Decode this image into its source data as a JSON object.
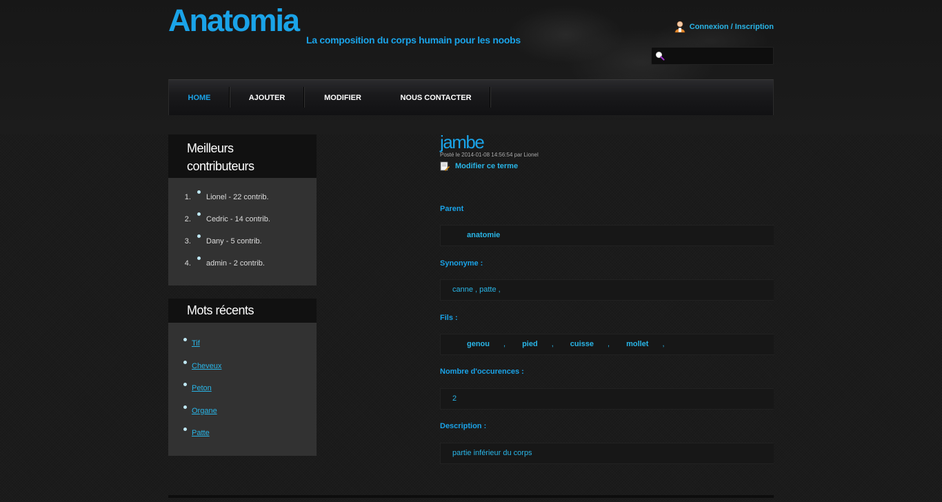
{
  "site": {
    "title": "Anatomia",
    "tagline": "La composition du corps humain pour les noobs",
    "login_label": "Connexion / Inscription",
    "search_placeholder": ""
  },
  "nav": {
    "items": [
      {
        "label": "HOME",
        "active": true
      },
      {
        "label": "AJOUTER",
        "active": false
      },
      {
        "label": "MODIFIER",
        "active": false
      },
      {
        "label": "NOUS CONTACTER",
        "active": false
      }
    ]
  },
  "sidebar": {
    "contributors": {
      "title": "Meilleurs contributeurs",
      "items": [
        "Lionel - 22 contrib.",
        "Cedric - 14 contrib.",
        "Dany - 5 contrib.",
        "admin - 2 contrib."
      ]
    },
    "recent": {
      "title": "Mots récents",
      "items": [
        "Tif",
        "Cheveux",
        "Peton",
        "Organe",
        "Patte"
      ]
    }
  },
  "term": {
    "title": "jambe",
    "meta": "Posté le 2014-01-08 14:56:54 par Lionel",
    "edit_label": "Modifier ce terme",
    "parent_label": "Parent",
    "parent_value": "anatomie",
    "synonym_label": "Synonyme :",
    "synonym_value": "canne , patte ,",
    "children_label": "Fils :",
    "children": [
      "genou",
      "pied",
      "cuisse",
      "mollet"
    ],
    "children_separator": ",",
    "occurrences_label": "Nombre d'occurences :",
    "occurrences_value": "2",
    "description_label": "Description :",
    "description_value": "partie inférieur du corps"
  },
  "colors": {
    "accent": "#1aa3e8",
    "link": "#29b6e8",
    "background": "#1b1b1b",
    "sidebar_bg": "#323232"
  },
  "icons": {
    "login": "user-icon",
    "search": "search-icon",
    "edit": "edit-document-icon"
  }
}
